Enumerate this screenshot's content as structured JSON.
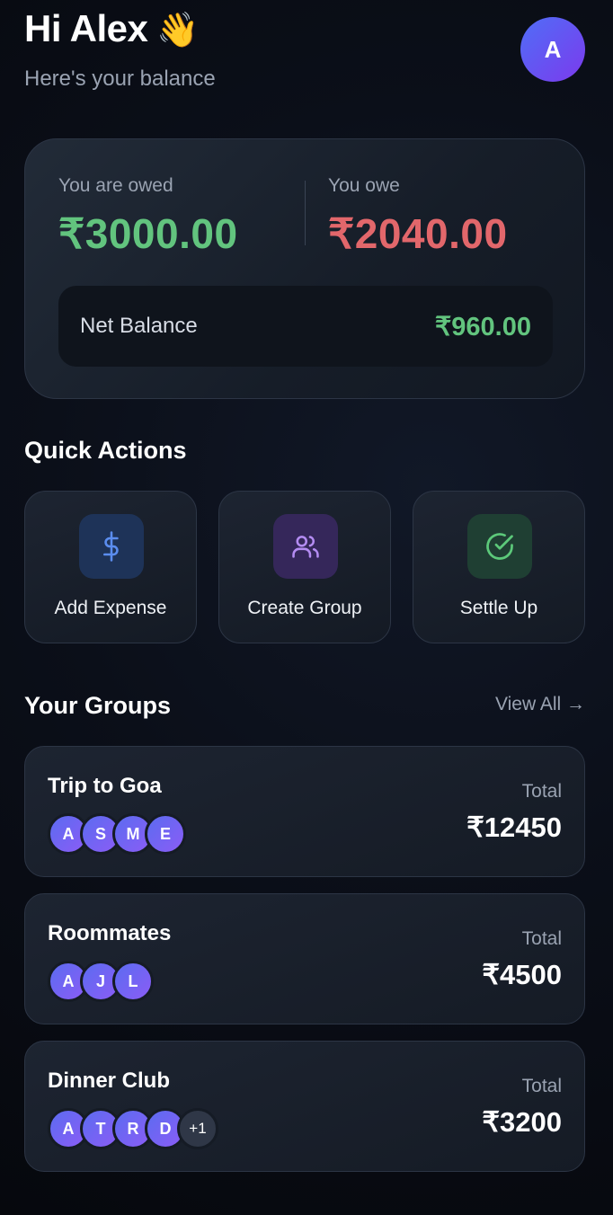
{
  "header": {
    "greeting": "Hi Alex",
    "wave_emoji": "👋",
    "subtitle": "Here's your balance",
    "avatar_initial": "A"
  },
  "balance": {
    "owed_label": "You are owed",
    "owed_amount": "₹3000.00",
    "owe_label": "You owe",
    "owe_amount": "₹2040.00",
    "net_label": "Net Balance",
    "net_amount": "₹960.00"
  },
  "quick_actions": {
    "title": "Quick Actions",
    "items": [
      {
        "label": "Add Expense",
        "icon": "dollar-icon",
        "color": "#5b8def"
      },
      {
        "label": "Create Group",
        "icon": "users-icon",
        "color": "#b48cf2"
      },
      {
        "label": "Settle Up",
        "icon": "check-circle-icon",
        "color": "#5cc97a"
      }
    ]
  },
  "groups": {
    "title": "Your Groups",
    "view_all": "View All →",
    "items": [
      {
        "name": "Trip to Goa",
        "members": [
          "A",
          "S",
          "M",
          "E"
        ],
        "total_label": "Total",
        "total": "₹12450"
      },
      {
        "name": "Roommates",
        "members": [
          "A",
          "J",
          "L"
        ],
        "total_label": "Total",
        "total": "₹4500"
      },
      {
        "name": "Dinner Club",
        "members": [
          "A",
          "T",
          "R",
          "D"
        ],
        "extra": "+1",
        "total_label": "Total",
        "total": "₹3200"
      }
    ]
  },
  "colors": {
    "positive": "#62c47e",
    "negative": "#e2676b",
    "avatar_gradient_start": "#4f6ef7",
    "avatar_gradient_end": "#7c3aed"
  }
}
